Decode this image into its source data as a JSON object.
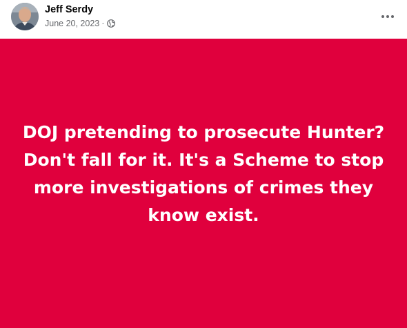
{
  "post": {
    "author": {
      "name": "Jeff Serdy"
    },
    "date": "June 20, 2023",
    "separator": "·",
    "privacy_icon": "globe-icon",
    "more_icon": "more-horizontal-icon",
    "background_color": "#e0003d",
    "text_color": "#ffffff",
    "text": "DOJ pretending to prosecute Hunter? Don't fall for it. It's a Scheme to stop more investigations of crimes they know exist."
  }
}
